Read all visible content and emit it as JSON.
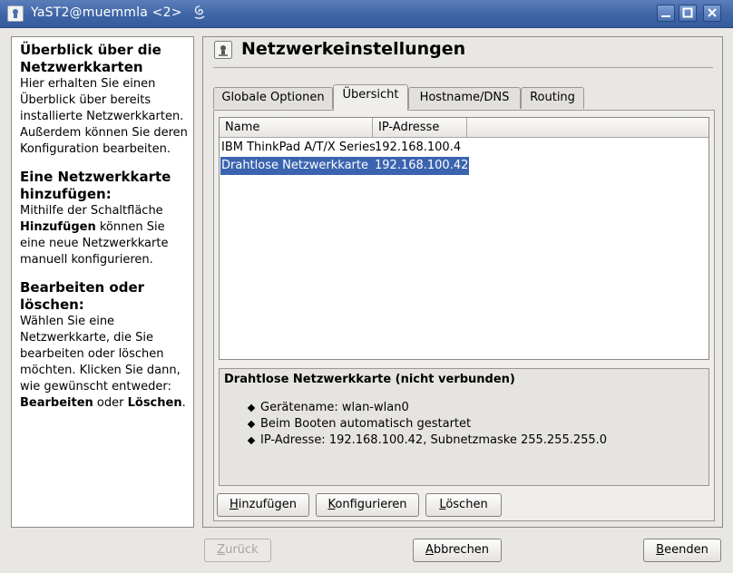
{
  "window": {
    "title": "YaST2@muemmla <2>"
  },
  "help": {
    "sections": [
      {
        "heading": "Überblick über die Netzwerkkarten",
        "text": "Hier erhalten Sie einen Überblick über bereits installierte Netzwerkkarten. Außerdem können Sie deren Konfiguration bearbeiten."
      },
      {
        "heading": "Eine Netzwerkkarte hinzufügen:",
        "text_before": "Mithilfe der Schaltfläche ",
        "bold": "Hinzufügen",
        "text_after": " können Sie eine neue Netzwerkkarte manuell konfigurieren."
      },
      {
        "heading": "Bearbeiten oder löschen:",
        "text_before": "Wählen Sie eine Netzwerkkarte, die Sie bearbeiten oder löschen möchten. Klicken Sie dann, wie gewünscht entweder: ",
        "bold1": "Bearbeiten",
        "middle": " oder ",
        "bold2": "Löschen",
        "end": "."
      }
    ]
  },
  "header": {
    "title": "Netzwerkeinstellungen",
    "icon": "network-settings-icon"
  },
  "tabs": [
    {
      "label": "Globale Optionen",
      "active": false
    },
    {
      "label": "Übersicht",
      "active": true
    },
    {
      "label": "Hostname/DNS",
      "active": false
    },
    {
      "label": "Routing",
      "active": false
    }
  ],
  "table": {
    "columns": [
      "Name",
      "IP-Adresse"
    ],
    "rows": [
      {
        "name": "IBM ThinkPad A/T/X Series",
        "ip": "192.168.100.4",
        "selected": false
      },
      {
        "name": "Drahtlose Netzwerkkarte",
        "ip": "192.168.100.42",
        "selected": true
      }
    ]
  },
  "details": {
    "title": "Drahtlose Netzwerkkarte (nicht verbunden)",
    "items": [
      "Gerätename: wlan-wlan0",
      "Beim Booten automatisch gestartet",
      "IP-Adresse: 192.168.100.42, Subnetzmaske 255.255.255.0"
    ]
  },
  "actions": {
    "add": {
      "u": "H",
      "rest": "inzufügen"
    },
    "configure": {
      "u": "K",
      "rest": "onfigurieren"
    },
    "delete": {
      "u": "L",
      "rest": "öschen"
    }
  },
  "footer": {
    "back": {
      "u": "Z",
      "rest": "urück",
      "enabled": false
    },
    "cancel": {
      "u": "A",
      "rest": "bbrechen"
    },
    "finish": {
      "u": "B",
      "rest": "eenden"
    }
  },
  "colors": {
    "titlebar": "#3f65a6",
    "selection": "#3b64b0",
    "background": "#e9e7e3"
  }
}
